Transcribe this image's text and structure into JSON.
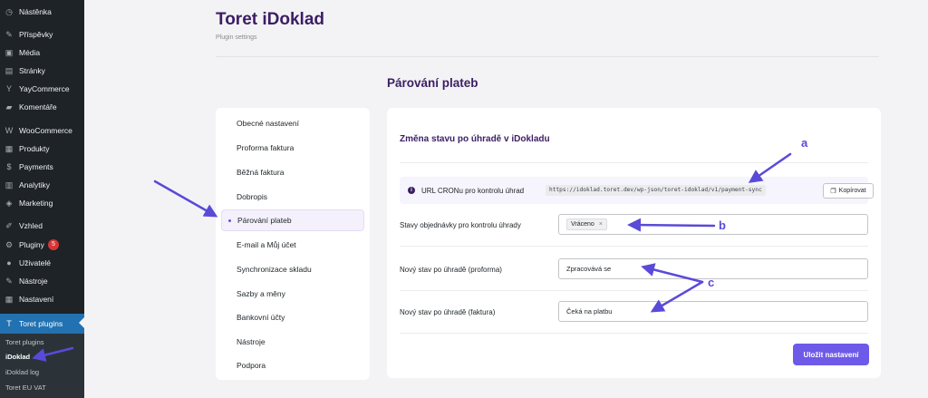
{
  "sidebar": {
    "items": [
      {
        "label": "Nástěnka",
        "icon": "dashboard-icon",
        "glyph": "◷"
      },
      {
        "label": "Příspěvky",
        "icon": "pushpin-icon",
        "glyph": "✎"
      },
      {
        "label": "Média",
        "icon": "media-icon",
        "glyph": "▣"
      },
      {
        "label": "Stránky",
        "icon": "pages-icon",
        "glyph": "▤"
      },
      {
        "label": "YayCommerce",
        "icon": "yaycommerce-icon",
        "glyph": "Y"
      },
      {
        "label": "Komentáře",
        "icon": "comments-icon",
        "glyph": "▰"
      },
      {
        "label": "WooCommerce",
        "icon": "woocommerce-icon",
        "glyph": "W"
      },
      {
        "label": "Produkty",
        "icon": "products-icon",
        "glyph": "▦"
      },
      {
        "label": "Payments",
        "icon": "payments-icon",
        "glyph": "$"
      },
      {
        "label": "Analytiky",
        "icon": "analytics-icon",
        "glyph": "▥"
      },
      {
        "label": "Marketing",
        "icon": "marketing-icon",
        "glyph": "◈"
      },
      {
        "label": "Vzhled",
        "icon": "appearance-icon",
        "glyph": "✐"
      },
      {
        "label": "Pluginy",
        "icon": "plugins-icon",
        "glyph": "⚙",
        "badge": "5"
      },
      {
        "label": "Uživatelé",
        "icon": "users-icon",
        "glyph": "●"
      },
      {
        "label": "Nástroje",
        "icon": "tools-icon",
        "glyph": "✎"
      },
      {
        "label": "Nastavení",
        "icon": "settings-icon",
        "glyph": "▦"
      },
      {
        "label": "Toret plugins",
        "icon": "toret-icon",
        "glyph": "T"
      }
    ],
    "submenu": [
      "Toret plugins",
      "iDoklad",
      "iDoklad log",
      "Toret EU VAT"
    ]
  },
  "header": {
    "title": "Toret iDoklad",
    "subtitle": "Plugin settings"
  },
  "section_title": "Párování plateb",
  "settings_nav": [
    "Obecné nastavení",
    "Proforma faktura",
    "Běžná faktura",
    "Dobropis",
    "Párování plateb",
    "E-mail a Můj účet",
    "Synchronizace skladu",
    "Sazby a měny",
    "Bankovní účty",
    "Nástroje",
    "Podpora"
  ],
  "card": {
    "title": "Změna stavu po úhradě v iDokladu",
    "cron_label": "URL CRONu pro kontrolu úhrad",
    "cron_url": "https://idoklad.toret.dev/wp-json/toret-idoklad/v1/payment-sync",
    "copy_label": "Kopírovat",
    "rows": [
      {
        "label": "Stavy objednávky pro kontrolu úhrady",
        "tag": "Vráceno",
        "tag_remove": "×"
      },
      {
        "label": "Nový stav po úhradě (proforma)",
        "value": "Zpracovává se"
      },
      {
        "label": "Nový stav po úhradě (faktura)",
        "value": "Čeká na platbu"
      }
    ],
    "save_label": "Uložit nastavení"
  },
  "annotations": {
    "letters": [
      "a",
      "b",
      "c"
    ],
    "color": "#5a4ad8"
  },
  "colors": {
    "accent": "#6d5ae8",
    "title": "#3b1e64",
    "wp_sidebar": "#1d2327",
    "wp_active": "#2271b1"
  }
}
